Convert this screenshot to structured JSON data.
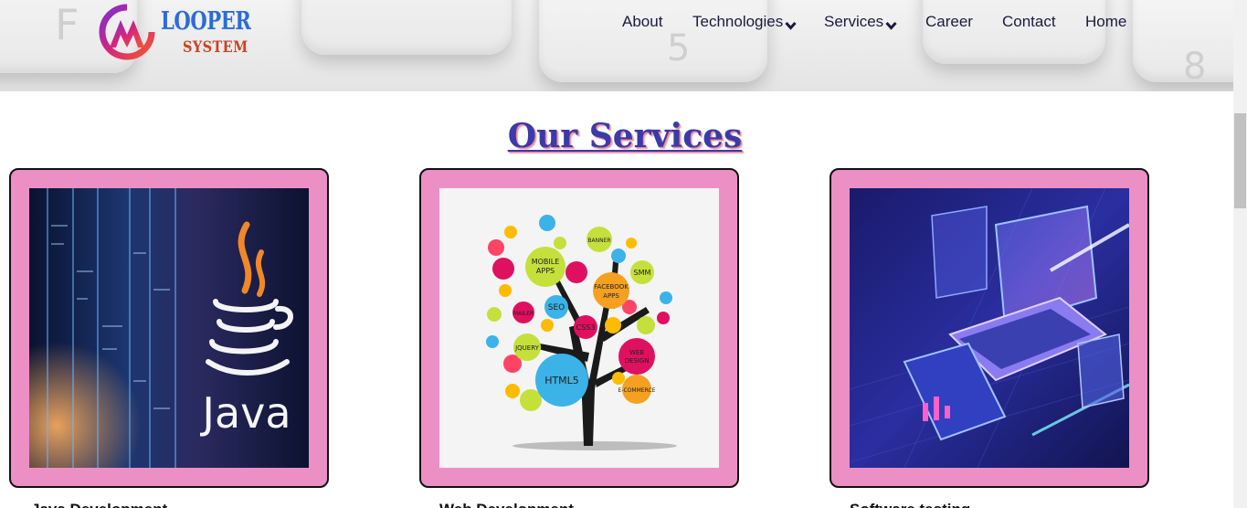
{
  "logo": {
    "top": "LOOPER",
    "bottom": "SYSTEM"
  },
  "nav": [
    {
      "label": "About",
      "dropdown": false
    },
    {
      "label": "Technologies",
      "dropdown": true
    },
    {
      "label": "Services",
      "dropdown": true
    },
    {
      "label": "Career",
      "dropdown": false
    },
    {
      "label": "Contact",
      "dropdown": false
    },
    {
      "label": "Home",
      "dropdown": false
    }
  ],
  "section_title": "Our Services",
  "cards": [
    {
      "image_word": "Java",
      "caption": "Java Development"
    },
    {
      "bubbles": [
        "MOBILE APPS",
        "BANNER",
        "FACEBOOK APPS",
        "SMM",
        "SEO",
        "MAILER",
        "CSS3",
        "JQUERY",
        "WEB DESIGN",
        "HTML5",
        "E-COMMERCE"
      ],
      "caption": "Web Development"
    },
    {
      "caption": "Software testing"
    }
  ],
  "colors": {
    "card_bg": "#ec8fc4",
    "title": "#3a3aa8",
    "nav_text": "#1a1a40"
  }
}
